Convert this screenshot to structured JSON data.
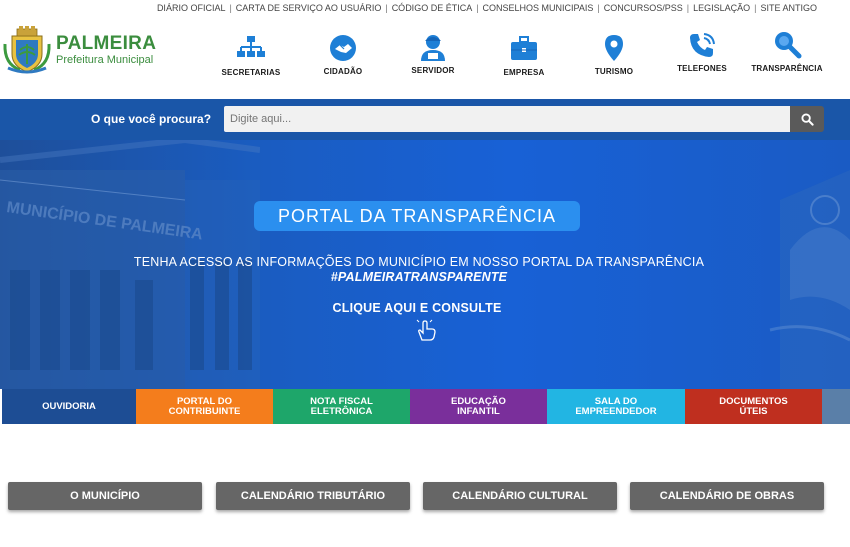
{
  "top_links": [
    "DIÁRIO OFICIAL",
    "CARTA DE SERVIÇO AO USUÁRIO",
    "CÓDIGO DE ÉTICA",
    "CONSELHOS MUNICIPAIS",
    "CONCURSOS/PSS",
    "LEGISLAÇÃO",
    "SITE ANTIGO"
  ],
  "logo": {
    "title": "PALMEIRA",
    "subtitle": "Prefeitura Municipal"
  },
  "nav": [
    {
      "label": "SECRETARIAS",
      "icon": "org-chart-icon"
    },
    {
      "label": "CIDADÃO",
      "icon": "handshake-icon"
    },
    {
      "label": "SERVIDOR",
      "icon": "worker-icon"
    },
    {
      "label": "EMPRESA",
      "icon": "briefcase-icon"
    },
    {
      "label": "TURISMO",
      "icon": "map-pin-icon"
    },
    {
      "label": "TELEFONES",
      "icon": "phone-icon"
    },
    {
      "label": "TRANSPARÊNCIA",
      "icon": "magnifier-icon"
    }
  ],
  "search": {
    "label": "O que você procura?",
    "placeholder": "Digite aqui..."
  },
  "banner": {
    "title": "PORTAL DA TRANSPARÊNCIA",
    "line1": "TENHA ACESSO AS INFORMAÇÕES DO MUNICÍPIO EM NOSSO PORTAL DA TRANSPARÊNCIA",
    "line2": "#PALMEIRATRANSPARENTE",
    "cta": "CLIQUE AQUI E CONSULTE",
    "building_sign": "MUNICÍPIO DE PALMEIRA"
  },
  "tabs": [
    {
      "line1": "OUVIDORIA",
      "line2": "",
      "color": "#1d4d94"
    },
    {
      "line1": "PORTAL DO",
      "line2": "CONTRIBUINTE",
      "color": "#f47d1c"
    },
    {
      "line1": "NOTA FISCAL",
      "line2": "ELETRÔNICA",
      "color": "#1ea66a"
    },
    {
      "line1": "EDUCAÇÃO",
      "line2": "INFANTIL",
      "color": "#7a2f9b"
    },
    {
      "line1": "SALA DO",
      "line2": "EMPREENDEDOR",
      "color": "#22b5e3"
    },
    {
      "line1": "DOCUMENTOS",
      "line2": "ÚTEIS",
      "color": "#bf2f1f"
    }
  ],
  "buttons": [
    "O MUNICÍPIO",
    "CALENDÁRIO TRIBUTÁRIO",
    "CALENDÁRIO CULTURAL",
    "CALENDÁRIO DE OBRAS"
  ],
  "colors": {
    "primary_blue": "#1a56a8",
    "icon_blue": "#1e7fd6",
    "green": "#3b8d3e",
    "gray_button": "#666666"
  }
}
